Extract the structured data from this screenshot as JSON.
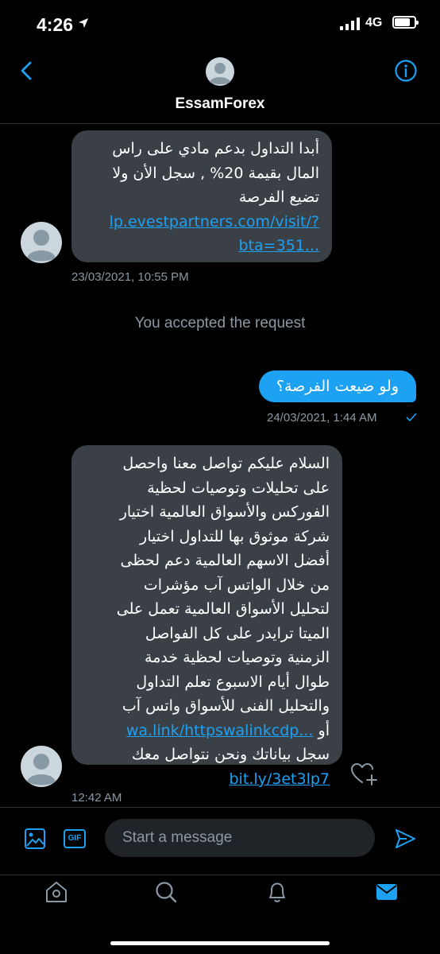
{
  "status_bar": {
    "time": "4:26",
    "network": "4G",
    "battery_level": 0.8
  },
  "header": {
    "contact_name": "EssamForex"
  },
  "messages": [
    {
      "direction": "incoming",
      "lines": [
        "أبدا التداول بدعم مادي على راس",
        "المال بقيمة 20% , سجل الأن ولا",
        "تضيع الفرصة"
      ],
      "link_lines": [
        "lp.evestpartners.com/visit/?",
        "bta=351..."
      ],
      "timestamp": "23/03/2021, 10:55 PM"
    },
    {
      "direction": "system",
      "text": "You accepted the request"
    },
    {
      "direction": "outgoing",
      "text": "ولو ضيعت الفرصة؟",
      "timestamp": "24/03/2021, 1:44 AM"
    },
    {
      "direction": "incoming",
      "lines": [
        "السلام عليكم تواصل معنا واحصل",
        "على تحليلات وتوصيات لحظية",
        "الفوركس والأسواق العالمية اختيار",
        "شركة موثوق بها للتداول اختيار",
        "أفضل الاسهم العالمية دعم لحظى",
        "من خلال الواتس آب مؤشرات",
        "لتحليل الأسواق العالمية تعمل على",
        "الميتا ترايدر على كل الفواصل",
        "الزمنية وتوصيات لحظية خدمة",
        "طوال أيام الاسبوع تعلم التداول",
        "والتحليل الفنى للأسواق واتس آب"
      ],
      "link_1": "wa.link/httpswalinkcdp...",
      "after_link_1": "أو",
      "line_before_link_2": "سجل بياناتك ونحن نتواصل معك",
      "link_2": "bit.ly/3et3lp7",
      "timestamp": "12:42 AM"
    }
  ],
  "composer": {
    "placeholder": "Start a message",
    "gif_label": "GIF"
  },
  "colors": {
    "accent": "#1da1f2",
    "incoming_bubble": "#3a4046",
    "muted_text": "#8b98a5"
  }
}
